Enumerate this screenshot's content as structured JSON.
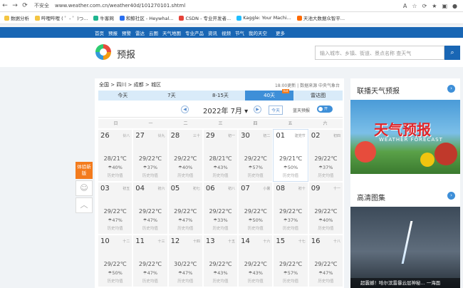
{
  "browser": {
    "security": "不安全",
    "url": "www.weather.com.cn/weather40d/101270101.shtml"
  },
  "bookmarks": [
    {
      "label": "数据分析",
      "color": "#f4c542"
    },
    {
      "label": "哔哩哔哩 ( ゜- ゜)つ...",
      "color": "#f4c542"
    },
    {
      "label": "牛客网",
      "color": "#1fb58f"
    },
    {
      "label": "和鲸社区 - Heywhal...",
      "color": "#2a6ff0"
    },
    {
      "label": "CSDN - 专业开发者...",
      "color": "#e5433a"
    },
    {
      "label": "Kaggle: Your Machi...",
      "color": "#20beff"
    },
    {
      "label": "天池大数据众智平...",
      "color": "#ff6a00"
    }
  ],
  "topnav": [
    "首页",
    "预报",
    "预警",
    "雷达",
    "云图",
    "天气地图",
    "专业产品",
    "资讯",
    "视频",
    "节气",
    "我的天空",
    "更多"
  ],
  "header": {
    "brand": "预报",
    "search_placeholder": "输入城市、乡镇、街道、景点名称 查天气"
  },
  "panel": {
    "breadcrumb": "全国 > 四川 > 成都 > 城区",
    "updated": "18:00更新 | 数据来源 中央气象台",
    "tabs": [
      "今天",
      "7天",
      "8-15天",
      "40天",
      "雷达图"
    ],
    "hot_badge": "hot",
    "month": "2022年 7月 ▾",
    "today_button": "今天",
    "toggle_label": "蓝天预报",
    "toggle_state": "开",
    "weekdays": [
      "日",
      "一",
      "二",
      "三",
      "四",
      "五",
      "六"
    ]
  },
  "calendar": [
    {
      "day": "26",
      "lunar": "廿八",
      "temp": "28/21℃",
      "rain": "40%",
      "hist": "历史均值"
    },
    {
      "day": "27",
      "lunar": "廿九",
      "temp": "29/22℃",
      "rain": "37%",
      "hist": "历史均值"
    },
    {
      "day": "28",
      "lunar": "三十",
      "temp": "29/22℃",
      "rain": "40%",
      "hist": "历史均值"
    },
    {
      "day": "29",
      "lunar": "初一",
      "temp": "28/21℃",
      "rain": "43%",
      "hist": "历史均值"
    },
    {
      "day": "30",
      "lunar": "初二",
      "temp": "29/22℃",
      "rain": "57%",
      "hist": "历史均值"
    },
    {
      "day": "01",
      "lunar": "建党节",
      "temp": "29/21℃",
      "rain": "50%",
      "hist": "历史均值"
    },
    {
      "day": "02",
      "lunar": "初四",
      "temp": "29/22℃",
      "rain": "37%",
      "hist": "历史均值"
    },
    {
      "day": "03",
      "lunar": "初五",
      "temp": "29/22℃",
      "rain": "47%",
      "hist": "历史均值"
    },
    {
      "day": "04",
      "lunar": "初六",
      "temp": "29/22℃",
      "rain": "47%",
      "hist": "历史均值"
    },
    {
      "day": "05",
      "lunar": "初七",
      "temp": "29/22℃",
      "rain": "47%",
      "hist": "历史均值"
    },
    {
      "day": "06",
      "lunar": "初八",
      "temp": "29/22℃",
      "rain": "33%",
      "hist": "历史均值"
    },
    {
      "day": "07",
      "lunar": "小暑",
      "temp": "29/22℃",
      "rain": "50%",
      "hist": "历史均值"
    },
    {
      "day": "08",
      "lunar": "初十",
      "temp": "29/22℃",
      "rain": "37%",
      "hist": "历史均值"
    },
    {
      "day": "09",
      "lunar": "十一",
      "temp": "29/22℃",
      "rain": "40%",
      "hist": "历史均值"
    },
    {
      "day": "10",
      "lunar": "十二",
      "temp": "29/22℃",
      "rain": "50%",
      "hist": "历史均值"
    },
    {
      "day": "11",
      "lunar": "十三",
      "temp": "29/22℃",
      "rain": "47%",
      "hist": "历史均值"
    },
    {
      "day": "12",
      "lunar": "十四",
      "temp": "30/22℃",
      "rain": "47%",
      "hist": "历史均值"
    },
    {
      "day": "13",
      "lunar": "十五",
      "temp": "29/22℃",
      "rain": "43%",
      "hist": "历史均值"
    },
    {
      "day": "14",
      "lunar": "十六",
      "temp": "29/22℃",
      "rain": "43%",
      "hist": "历史均值"
    },
    {
      "day": "15",
      "lunar": "十七",
      "temp": "29/22℃",
      "rain": "57%",
      "hist": "历史均值"
    },
    {
      "day": "16",
      "lunar": "十八",
      "temp": "29/22℃",
      "rain": "47%",
      "hist": "历史均值"
    }
  ],
  "side": {
    "live_title": "联播天气预报",
    "live_img_title": "天气预报",
    "live_img_sub": "WEATHER FORECAST",
    "hd_title": "高清图集",
    "hd_caption": "超震撼！哈尔滨雷暴云层神秘... 一海面"
  },
  "float": {
    "feedback": "体验新版"
  }
}
